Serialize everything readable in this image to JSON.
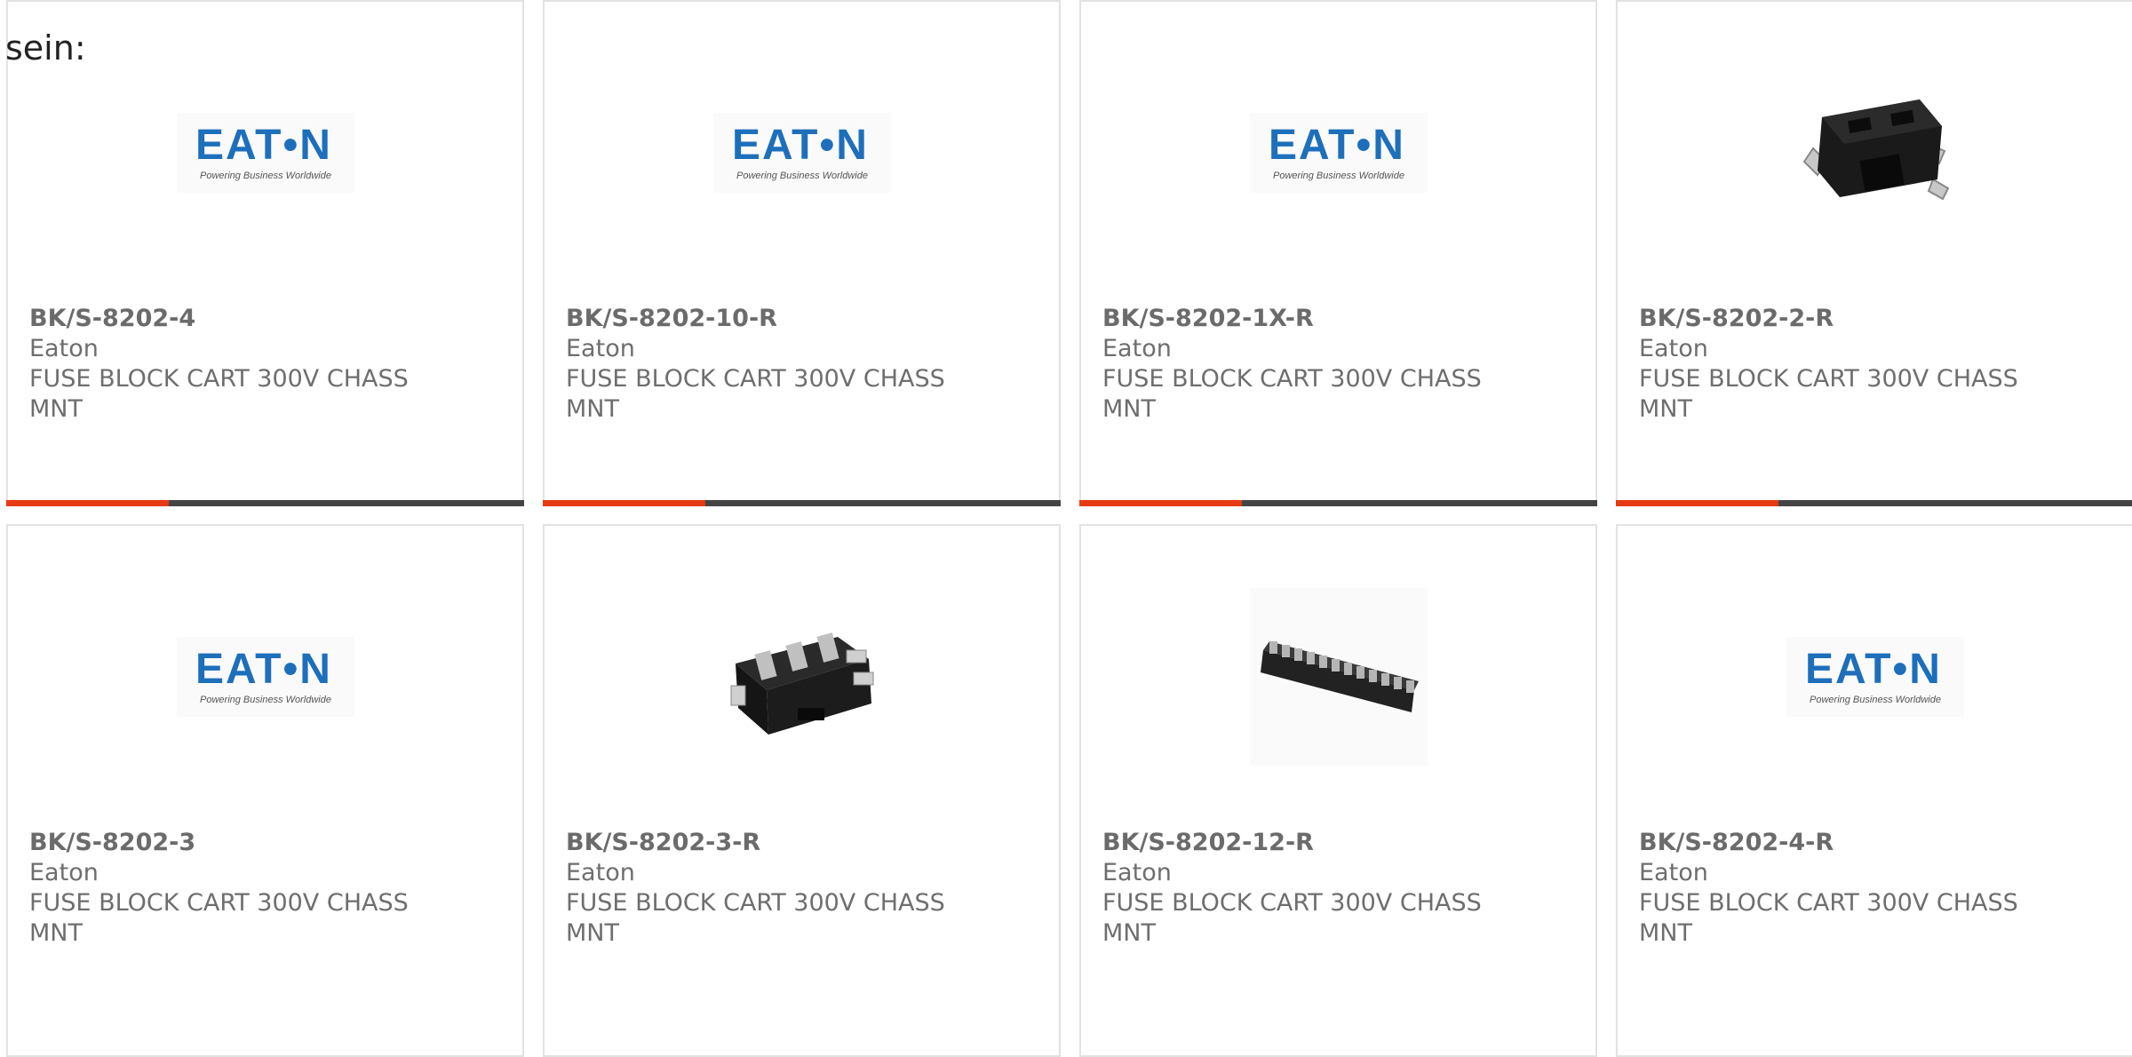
{
  "intro_text": "sein:",
  "colors": {
    "accent": "#e53a14",
    "bar": "#444444",
    "eaton_blue": "#1d6fbb"
  },
  "products": [
    {
      "part": "BK/S-8202-4",
      "brand": "Eaton",
      "desc": "FUSE BLOCK CART 300V CHASS MNT",
      "image": "eaton-logo",
      "logo_tagline": "Powering Business Worldwide"
    },
    {
      "part": "BK/S-8202-10-R",
      "brand": "Eaton",
      "desc": "FUSE BLOCK CART 300V CHASS MNT",
      "image": "eaton-logo",
      "logo_tagline": "Powering Business Worldwide"
    },
    {
      "part": "BK/S-8202-1X-R",
      "brand": "Eaton",
      "desc": "FUSE BLOCK CART 300V CHASS MNT",
      "image": "eaton-logo",
      "logo_tagline": "Powering Business Worldwide"
    },
    {
      "part": "BK/S-8202-2-R",
      "brand": "Eaton",
      "desc": "FUSE BLOCK CART 300V CHASS MNT",
      "image": "fuse-block-2pole"
    },
    {
      "part": "BK/S-8202-3",
      "brand": "Eaton",
      "desc": "FUSE BLOCK CART 300V CHASS MNT",
      "image": "eaton-logo",
      "logo_tagline": "Powering Business Worldwide"
    },
    {
      "part": "BK/S-8202-3-R",
      "brand": "Eaton",
      "desc": "FUSE BLOCK CART 300V CHASS MNT",
      "image": "fuse-block-3pole"
    },
    {
      "part": "BK/S-8202-12-R",
      "brand": "Eaton",
      "desc": "FUSE BLOCK CART 300V CHASS MNT",
      "image": "fuse-block-12pole"
    },
    {
      "part": "BK/S-8202-4-R",
      "brand": "Eaton",
      "desc": "FUSE BLOCK CART 300V CHASS MNT",
      "image": "eaton-logo",
      "logo_tagline": "Powering Business Worldwide"
    }
  ]
}
